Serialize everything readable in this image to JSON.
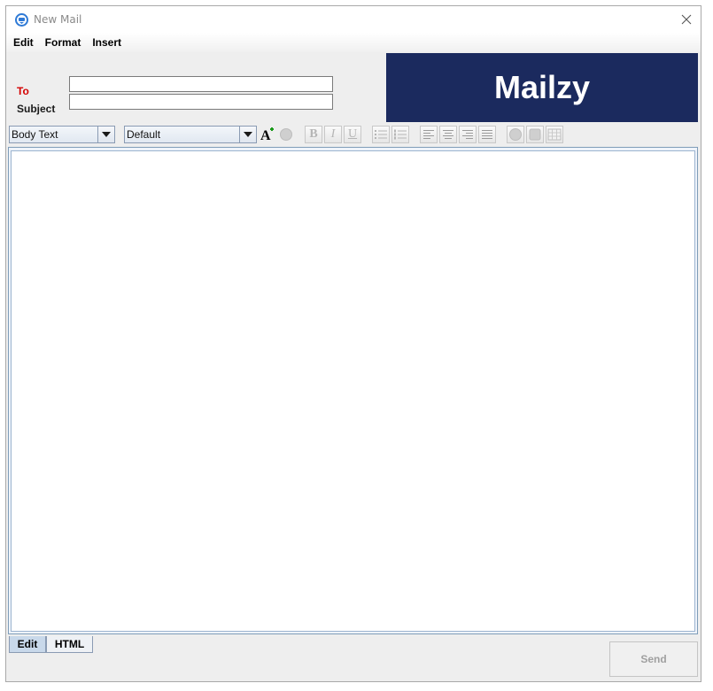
{
  "window": {
    "title": "New Mail",
    "close_glyph": "✕"
  },
  "menu": {
    "items": [
      {
        "label": "Edit"
      },
      {
        "label": "Format"
      },
      {
        "label": "Insert"
      }
    ]
  },
  "header": {
    "to_label": "To",
    "to_value": "",
    "subject_label": "Subject",
    "subject_value": "",
    "brand": "Mailzy",
    "brand_color": "#1b2a5e",
    "to_label_color": "#d40000"
  },
  "toolbar": {
    "style_value": "Body Text",
    "font_value": "Default",
    "bold_glyph": "B",
    "italic_glyph": "I",
    "underline_glyph": "U",
    "font_color_glyph": "A",
    "icons": [
      "font-color-icon",
      "highlight-icon",
      "bold-icon",
      "italic-icon",
      "underline-icon",
      "bullet-list-icon",
      "numbered-list-icon",
      "align-left-icon",
      "align-center-icon",
      "align-right-icon",
      "align-justify-icon",
      "insert-image-icon",
      "insert-frame-icon",
      "insert-table-icon"
    ]
  },
  "editor": {
    "content": ""
  },
  "tabs": [
    {
      "label": "Edit",
      "selected": true
    },
    {
      "label": "HTML",
      "selected": false
    }
  ],
  "footer": {
    "send_label": "Send"
  }
}
